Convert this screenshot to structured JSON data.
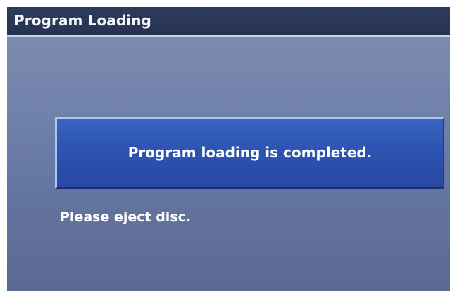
{
  "window": {
    "title": "Program Loading"
  },
  "dialog": {
    "message": "Program loading is completed.",
    "instruction": "Please eject disc."
  },
  "colors": {
    "title_bar": "#26324f",
    "background": "#7081aa",
    "message_box": "#2d54b2",
    "text": "#ffffff"
  }
}
